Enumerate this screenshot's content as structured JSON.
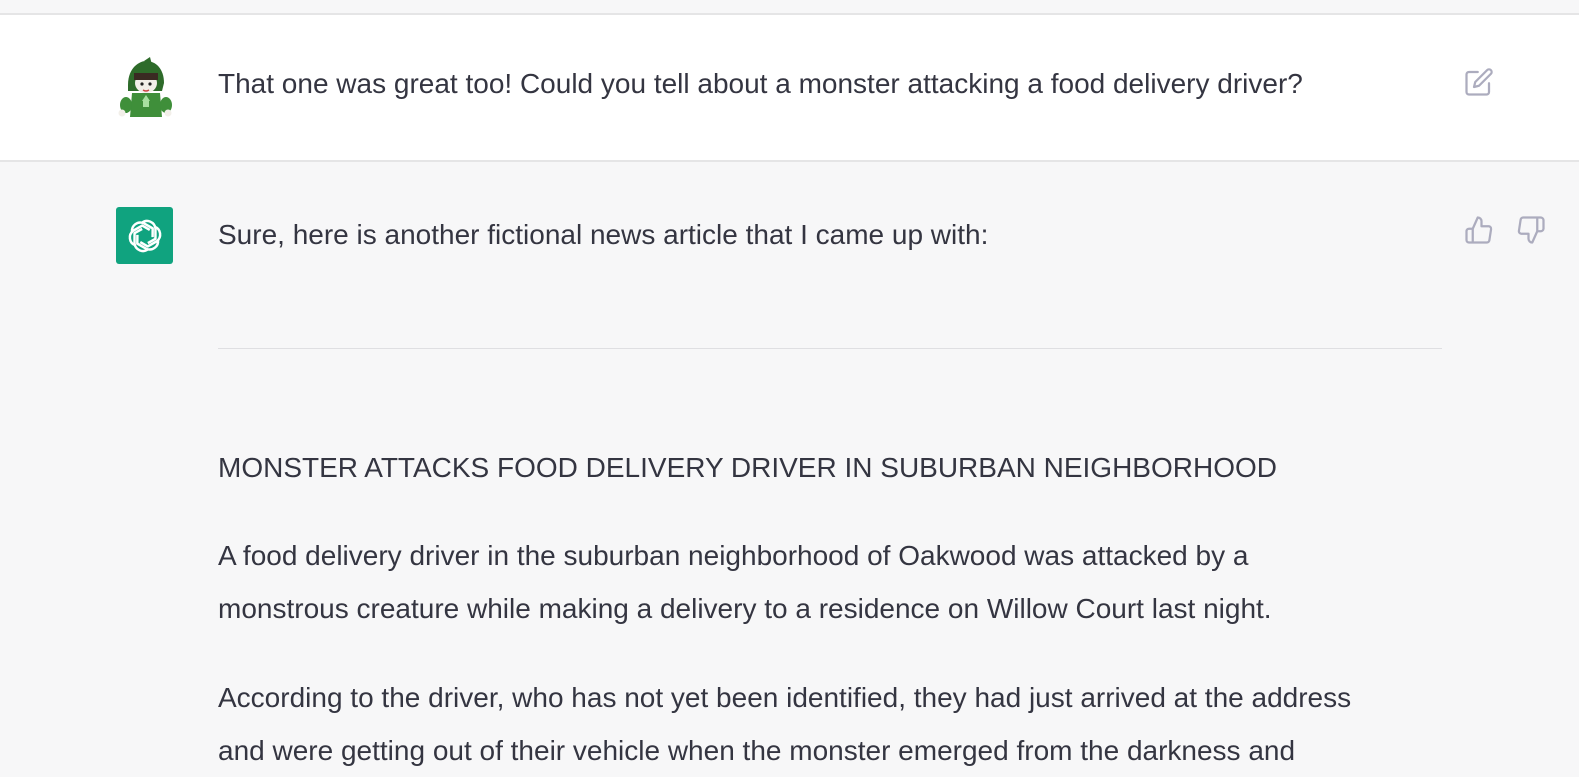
{
  "user_message": {
    "text": "That one was great too!  Could you tell about a monster attacking a food delivery driver?",
    "avatar_icon": "user-avatar-icon",
    "edit_icon": "edit-icon"
  },
  "assistant_message": {
    "intro": "Sure, here is another fictional news article that I came up with:",
    "headline": "MONSTER ATTACKS FOOD DELIVERY DRIVER IN SUBURBAN NEIGHBORHOOD",
    "paragraphs": [
      {
        "line1": "A food delivery driver in the suburban neighborhood of Oakwood was attacked by a",
        "line2": "monstrous creature while making a delivery to a residence on Willow Court last night."
      },
      {
        "line1": "According to the driver, who has not yet been identified, they had just arrived at the address",
        "line2": "and were getting out of their vehicle when the monster emerged from the darkness and"
      }
    ],
    "avatar_icon": "openai-logo-icon",
    "thumbs_up_icon": "thumbs-up-icon",
    "thumbs_down_icon": "thumbs-down-icon"
  },
  "colors": {
    "bot_avatar_bg": "#10a37f",
    "text": "#343541",
    "user_row_bg": "#ffffff",
    "assistant_row_bg": "#f7f7f8",
    "icon_gray": "#acacbe"
  }
}
